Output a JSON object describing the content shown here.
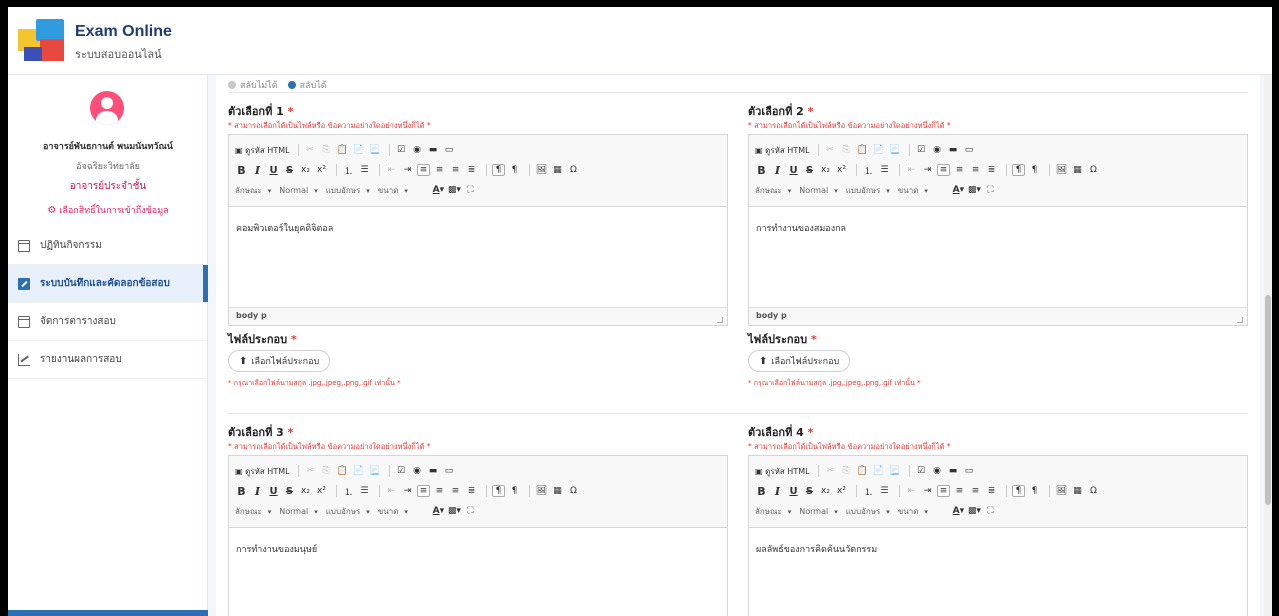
{
  "header": {
    "title": "Exam Online",
    "subtitle": "ระบบสอบออนไลน์"
  },
  "user": {
    "name": "อาจารย์พันธกานต์ พนมนันทวัณน์",
    "rank": "อัจฉริยะวิทยาลัย",
    "role": "อาจารย์ประจำชั้น",
    "permission_link": "เลือกสิทธิ์ในการเข้าถึงข้อมูล"
  },
  "sidebar": {
    "items": [
      {
        "label": "ปฏิทินกิจกรรม",
        "icon": "calendar-icon",
        "active": false
      },
      {
        "label": "ระบบบันทึกและคัดลอกข้อสอบ",
        "icon": "edit-icon",
        "active": true
      },
      {
        "label": "จัดการตารางสอบ",
        "icon": "calendar-icon",
        "active": false
      },
      {
        "label": "รายงานผลการสอบ",
        "icon": "chart-icon",
        "active": false
      }
    ]
  },
  "shuffle": {
    "off_label": "สลับไม่ได้",
    "on_label": "สลับได้",
    "selected": "on"
  },
  "editor": {
    "toolbar": {
      "source": "ดูรหัส HTML",
      "style_label": "ลักษณะ",
      "format_value": "Normal",
      "font_label": "แบบอักษร",
      "size_label": "ขนาด"
    },
    "path": "body  p"
  },
  "choices": [
    {
      "label": "ตัวเลือกที่ 1",
      "hint": "* สามารถเลือกได้เป็นไฟล์หรือ ข้อความอย่างใดอย่างหนึ่งก็ได้ *",
      "content": "คอมพิวเตอร์ในยุคดิจิตอล",
      "attach_label": "ไฟล์ประกอบ",
      "attach_button": "เลือกไฟล์ประกอบ",
      "attach_note": "* กรุณาเลือกไฟล์นามสกุล .jpg,.jpeg,.png,.gif เท่านั้น *"
    },
    {
      "label": "ตัวเลือกที่ 2",
      "hint": "* สามารถเลือกได้เป็นไฟล์หรือ ข้อความอย่างใดอย่างหนึ่งก็ได้ *",
      "content": "การทำงานของสมองกล",
      "attach_label": "ไฟล์ประกอบ",
      "attach_button": "เลือกไฟล์ประกอบ",
      "attach_note": "* กรุณาเลือกไฟล์นามสกุล .jpg,.jpeg,.png,.gif เท่านั้น *"
    },
    {
      "label": "ตัวเลือกที่ 3",
      "hint": "* สามารถเลือกได้เป็นไฟล์หรือ ข้อความอย่างใดอย่างหนึ่งก็ได้ *",
      "content": "การทำงานของมนุษย์"
    },
    {
      "label": "ตัวเลือกที่ 4",
      "hint": "* สามารถเลือกได้เป็นไฟล์หรือ ข้อความอย่างใดอย่างหนึ่งก็ได้ *",
      "content": "ผลลัพธ์ของการคิดค้นนวัตกรรม"
    }
  ],
  "colors": {
    "accent": "#2c6fb5",
    "required": "#e53935",
    "avatar": "#ff4e7a"
  }
}
